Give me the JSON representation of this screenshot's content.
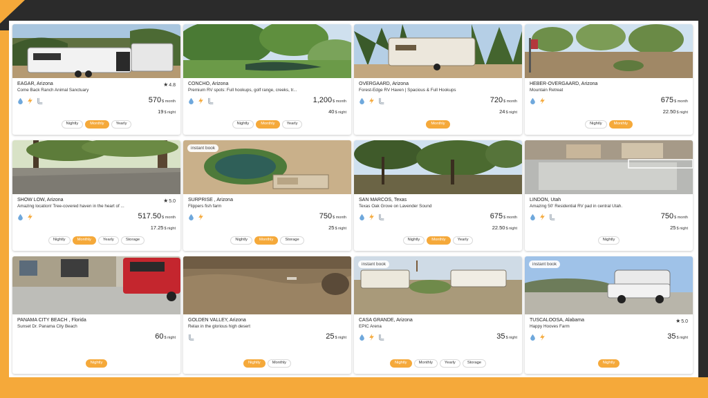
{
  "colors": {
    "accent": "#f5a93a",
    "background": "#2b2b2b",
    "card": "#ffffff"
  },
  "listings": [
    {
      "location": "EAGAR, Arizona",
      "title": "Come Back Ranch Animal Sanctuary",
      "rating": "4.8",
      "badge": "",
      "amenities": [
        "water-icon",
        "electric-icon",
        "sewer-icon"
      ],
      "price_main": "570",
      "price_main_unit": "month",
      "price_sub": "19",
      "price_sub_unit": "night",
      "tabs": [
        "Nightly",
        "Monthly",
        "Yearly"
      ],
      "active": "Monthly",
      "scene": "rv-forest"
    },
    {
      "location": "CONCHO, Arizona",
      "title": "Premium RV spots: Full hookups, golf range, creeks, tr...",
      "rating": "",
      "badge": "",
      "amenities": [
        "water-icon",
        "electric-icon",
        "sewer-icon"
      ],
      "price_main": "1,200",
      "price_main_unit": "month",
      "price_sub": "40",
      "price_sub_unit": "night",
      "tabs": [
        "Nightly",
        "Monthly",
        "Yearly"
      ],
      "active": "Monthly",
      "scene": "pond-trees"
    },
    {
      "location": "OVERGAARD, Arizona",
      "title": "Forest-Edge RV Haven | Spacious & Full Hookups",
      "rating": "",
      "badge": "",
      "amenities": [
        "water-icon",
        "electric-icon",
        "sewer-icon"
      ],
      "price_main": "720",
      "price_main_unit": "month",
      "price_sub": "24",
      "price_sub_unit": "night",
      "tabs": [
        "Monthly"
      ],
      "active": "Monthly",
      "scene": "rv-pines"
    },
    {
      "location": "HEBER-OVERGAARD, Arizona",
      "title": "Mountain Retreat",
      "rating": "",
      "badge": "",
      "amenities": [
        "water-icon",
        "electric-icon"
      ],
      "price_main": "675",
      "price_main_unit": "month",
      "price_sub": "22.50",
      "price_sub_unit": "night",
      "tabs": [
        "Nightly",
        "Monthly"
      ],
      "active": "Monthly",
      "scene": "orchard"
    },
    {
      "location": "SHOW LOW, Arizona",
      "title": "Amazing location! Tree-covered haven in the heart of ...",
      "rating": "5.0",
      "badge": "",
      "amenities": [
        "water-icon",
        "electric-icon"
      ],
      "price_main": "517.50",
      "price_main_unit": "month",
      "price_sub": "17.25",
      "price_sub_unit": "night",
      "tabs": [
        "Nightly",
        "Monthly",
        "Yearly",
        "Storage"
      ],
      "active": "Monthly",
      "scene": "pine-lot"
    },
    {
      "location": "SURPRISE , Arizona",
      "title": "Flippers fish farm",
      "rating": "",
      "badge": "instant book",
      "amenities": [
        "water-icon",
        "electric-icon"
      ],
      "price_main": "750",
      "price_main_unit": "month",
      "price_sub": "25",
      "price_sub_unit": "night",
      "tabs": [
        "Nightly",
        "Monthly",
        "Storage"
      ],
      "active": "Monthly",
      "scene": "aerial-pond"
    },
    {
      "location": "SAN MARCOS, Texas",
      "title": "Texas Oak Grove on Lavender Sound",
      "rating": "",
      "badge": "",
      "amenities": [
        "water-icon",
        "electric-icon",
        "sewer-icon"
      ],
      "price_main": "675",
      "price_main_unit": "month",
      "price_sub": "22.50",
      "price_sub_unit": "night",
      "tabs": [
        "Nightly",
        "Monthly",
        "Yearly"
      ],
      "active": "Monthly",
      "scene": "oak-grove"
    },
    {
      "location": "LINDON, Utah",
      "title": "Amazing 50' Residential RV pad in central Utah.",
      "rating": "",
      "badge": "",
      "amenities": [
        "water-icon",
        "electric-icon",
        "sewer-icon"
      ],
      "price_main": "750",
      "price_main_unit": "month",
      "price_sub": "25",
      "price_sub_unit": "night",
      "tabs": [
        "Nightly"
      ],
      "active": "",
      "scene": "concrete-pad"
    },
    {
      "location": "PANAMA CITY BEACH , Florida",
      "title": "Sunset Dr. Panama City Beach",
      "rating": "",
      "badge": "",
      "amenities": [],
      "price_main": "60",
      "price_main_unit": "night",
      "price_sub": "",
      "price_sub_unit": "",
      "tabs": [
        "Nightly"
      ],
      "active": "Nightly",
      "scene": "driveway-truck"
    },
    {
      "location": "GOLDEN VALLEY, Arizona",
      "title": "Relax in the glorious high desert",
      "rating": "",
      "badge": "",
      "amenities": [
        "sewer-icon"
      ],
      "price_main": "25",
      "price_main_unit": "night",
      "price_sub": "",
      "price_sub_unit": "",
      "tabs": [
        "Nightly",
        "Monthly"
      ],
      "active": "Nightly",
      "scene": "desert"
    },
    {
      "location": "CASA GRANDE, Arizona",
      "title": "EPIC Arena",
      "rating": "",
      "badge": "instant book",
      "amenities": [
        "water-icon",
        "electric-icon",
        "sewer-icon"
      ],
      "price_main": "35",
      "price_main_unit": "night",
      "price_sub": "",
      "price_sub_unit": "",
      "tabs": [
        "Nightly",
        "Monthly",
        "Yearly",
        "Storage"
      ],
      "active": "Nightly",
      "scene": "rv-park"
    },
    {
      "location": "TUSCALOOSA, Alabama",
      "title": "Happy Hooves Farm",
      "rating": "5.0",
      "badge": "instant book",
      "amenities": [
        "water-icon",
        "electric-icon"
      ],
      "price_main": "35",
      "price_main_unit": "night",
      "price_sub": "",
      "price_sub_unit": "",
      "tabs": [
        "Nightly"
      ],
      "active": "Nightly",
      "scene": "truck-camper"
    }
  ]
}
